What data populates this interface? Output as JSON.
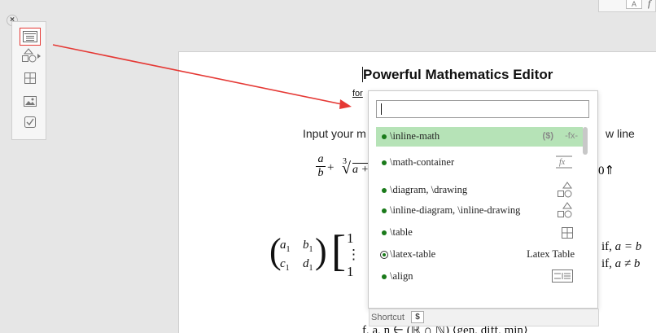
{
  "topbar": {
    "button_label": "A",
    "fragment": "f"
  },
  "toolbar": {
    "close_label": "×",
    "buttons": [
      {
        "icon": "text-block-icon",
        "active": true
      },
      {
        "icon": "shapes-icon"
      },
      {
        "icon": "table-icon"
      },
      {
        "icon": "image-icon"
      },
      {
        "icon": "checkbox-icon"
      }
    ]
  },
  "doc": {
    "title": "Powerful Mathematics Editor",
    "subtitle": "for",
    "line1_left": "Input your m",
    "line1_right": "w line",
    "frac_num": "a",
    "frac_den": "b",
    "sqrt_index": "3",
    "sqrt_body": "a +",
    "right_fragment": "0⇑",
    "matrix": {
      "a1": "a",
      "b1": "b",
      "c1": "c",
      "d1": "d",
      "sub": "1"
    },
    "bracket_vals": [
      "1",
      "⋮",
      "1"
    ],
    "cond1_if": "if,",
    "cond1_expr": "a = b",
    "cond2_if": "if,",
    "cond2_expr": "a ≠ b",
    "bottom_math": "f, a, n ∈ (ℝ ∩ ℕ) ⟨gen, diff, min⟩"
  },
  "popup": {
    "search_value": "",
    "items": [
      {
        "label": "\\inline-math",
        "right": "($)",
        "right2": "-fx-",
        "selected": true
      },
      {
        "label": "\\math-container",
        "icon": "math-container-icon",
        "icon_text": "fx"
      },
      {
        "label": "\\diagram, \\drawing",
        "icon": "diagram-icon"
      },
      {
        "label": "\\inline-diagram, \\inline-drawing",
        "icon": "inline-diagram-icon"
      },
      {
        "label": "\\table",
        "icon": "table-icon"
      },
      {
        "label": "\\latex-table",
        "right": "Latex Table",
        "radio": true
      },
      {
        "label": "\\align",
        "icon": "align-icon"
      }
    ],
    "footer": {
      "shortcut_label": "Shortcut",
      "key": "$"
    }
  }
}
